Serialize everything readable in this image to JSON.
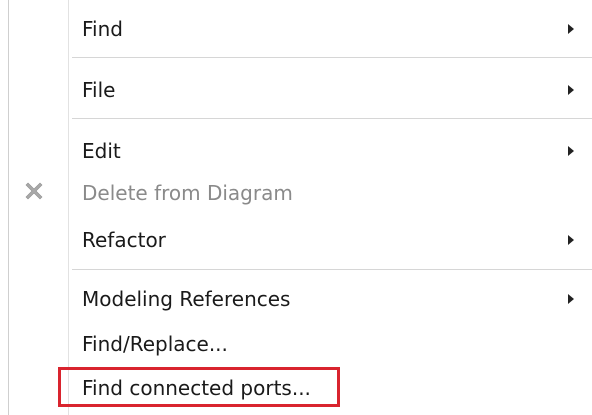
{
  "context_menu": {
    "items": [
      {
        "label": "Find",
        "submenu": true,
        "enabled": true
      },
      {
        "label": "File",
        "submenu": true,
        "enabled": true
      },
      {
        "label": "Edit",
        "submenu": true,
        "enabled": true
      },
      {
        "label": "Delete from Diagram",
        "submenu": false,
        "enabled": false,
        "icon": "delete-x-icon"
      },
      {
        "label": "Refactor",
        "submenu": true,
        "enabled": true
      },
      {
        "label": "Modeling References",
        "submenu": true,
        "enabled": true
      },
      {
        "label": "Find/Replace...",
        "submenu": false,
        "enabled": true
      },
      {
        "label": "Find connected ports...",
        "submenu": false,
        "enabled": true,
        "highlighted": true
      }
    ],
    "highlight_color": "#d9242e"
  }
}
